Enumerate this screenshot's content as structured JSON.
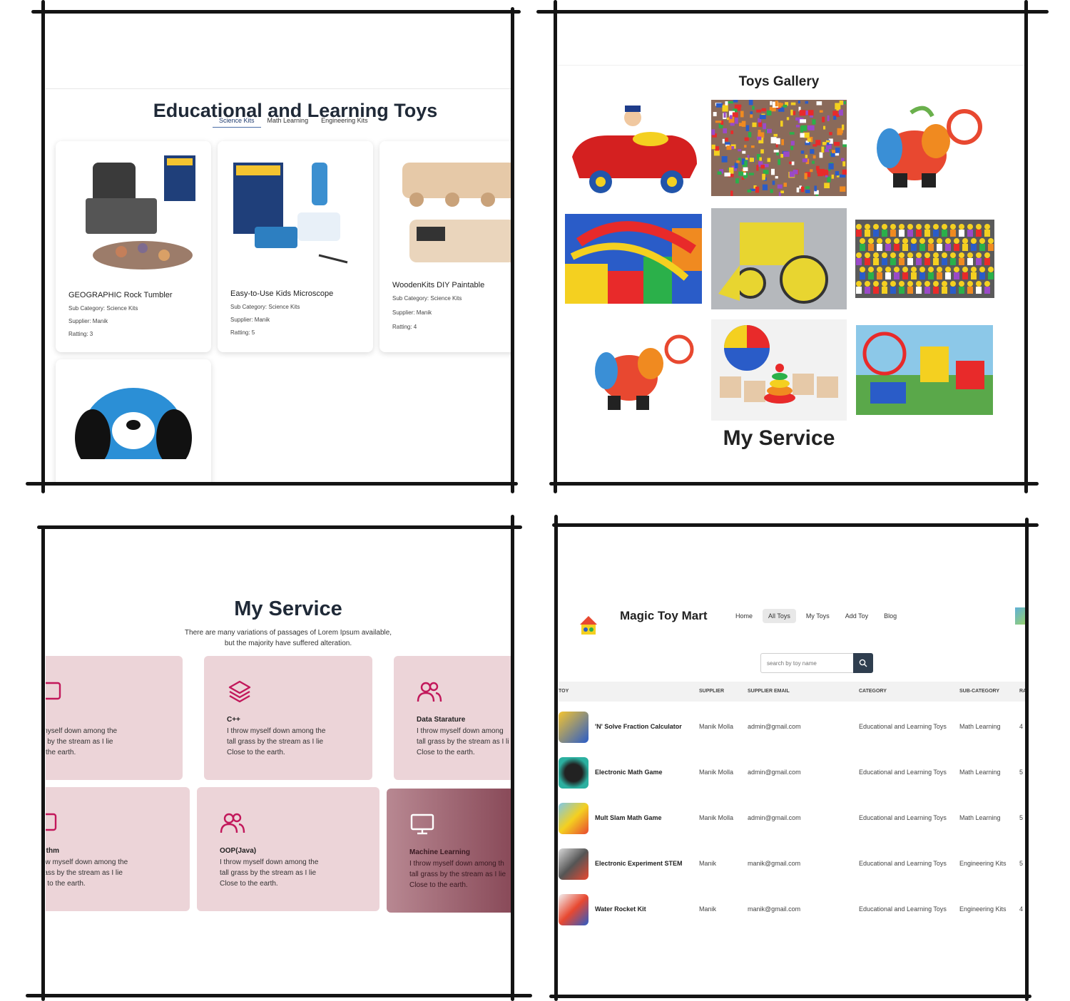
{
  "panel1": {
    "section_title": "Educational and Learning Toys",
    "tabs": [
      "Science Kits",
      "Math Learning",
      "Engineering Kits"
    ],
    "cards": [
      {
        "name": "GEOGRAPHIC Rock Tumbler",
        "sub_category": "Sub Category: Science Kits",
        "supplier": "Supplier: Manik",
        "rating": "Ratting: 3"
      },
      {
        "name": "Easy-to-Use Kids Microscope",
        "sub_category": "Sub Category: Science Kits",
        "supplier": "Supplier: Manik",
        "rating": "Ratting: 5"
      },
      {
        "name": "WoodenKits DIY Paintable",
        "sub_category": "Sub Category: Science Kits",
        "supplier": "Supplier: Manik",
        "rating": "Ratting: 4"
      }
    ]
  },
  "panel2": {
    "gallery_title": "Toys Gallery",
    "service_title": "My Service"
  },
  "panel3": {
    "title": "My Service",
    "subtitle_line1": "There are many variations of passages of Lorem Ipsum available,",
    "subtitle_line2": "but the majority have suffered alteration.",
    "cards": [
      {
        "name": "",
        "line1": "hrow myself down among the",
        "line2": "l grass by the stream as I lie",
        "line3": "ose to the earth."
      },
      {
        "name": "C++",
        "line1": "I throw myself down among the",
        "line2": "tall grass by the stream as I lie",
        "line3": "Close to the earth."
      },
      {
        "name": "Data Starature",
        "line1": "I throw myself down among",
        "line2": "tall grass by the stream as I li",
        "line3": "Close to the earth."
      },
      {
        "name": "rithm",
        "line1": "ow myself down among the",
        "line2": "rass by the stream as I lie",
        "line3": "e to the earth."
      },
      {
        "name": "OOP(Java)",
        "line1": "I throw myself down among the",
        "line2": "tall grass by the stream as I lie",
        "line3": "Close to the earth."
      },
      {
        "name": "Machine Learning",
        "line1": "I throw myself down among th",
        "line2": "tall grass by the stream as I lie",
        "line3": "Close to the earth."
      }
    ]
  },
  "panel4": {
    "brand": "Magic Toy Mart",
    "nav": [
      "Home",
      "All Toys",
      "My Toys",
      "Add Toy",
      "Blog"
    ],
    "nav_active": "All Toys",
    "search_placeholder": "search by toy name",
    "headers": [
      "TOY",
      "SUPPLIER",
      "SUPPLIER EMAIL",
      "CATEGORY",
      "SUB-CATEGORY",
      "RA"
    ],
    "rows": [
      {
        "name": "'N' Solve Fraction Calculator",
        "supplier": "Manik Molla",
        "email": "admin@gmail.com",
        "category": "Educational and Learning Toys",
        "sub": "Math Learning",
        "rating": "4"
      },
      {
        "name": "Electronic Math Game",
        "supplier": "Manik Molla",
        "email": "admin@gmail.com",
        "category": "Educational and Learning Toys",
        "sub": "Math Learning",
        "rating": "5"
      },
      {
        "name": "Mult Slam Math Game",
        "supplier": "Manik Molla",
        "email": "admin@gmail.com",
        "category": "Educational and Learning Toys",
        "sub": "Math Learning",
        "rating": "5"
      },
      {
        "name": "Electronic Experiment STEM",
        "supplier": "Manik",
        "email": "manik@gmail.com",
        "category": "Educational and Learning Toys",
        "sub": "Engineering Kits",
        "rating": "5"
      },
      {
        "name": "Water Rocket Kit",
        "supplier": "Manik",
        "email": "manik@gmail.com",
        "category": "Educational and Learning Toys",
        "sub": "Engineering Kits",
        "rating": "4"
      }
    ]
  },
  "colors": {
    "service_card": "#ecd4d8",
    "accent_pink": "#c2185b",
    "search_button": "#2f3e4f",
    "frame": "#141414"
  }
}
